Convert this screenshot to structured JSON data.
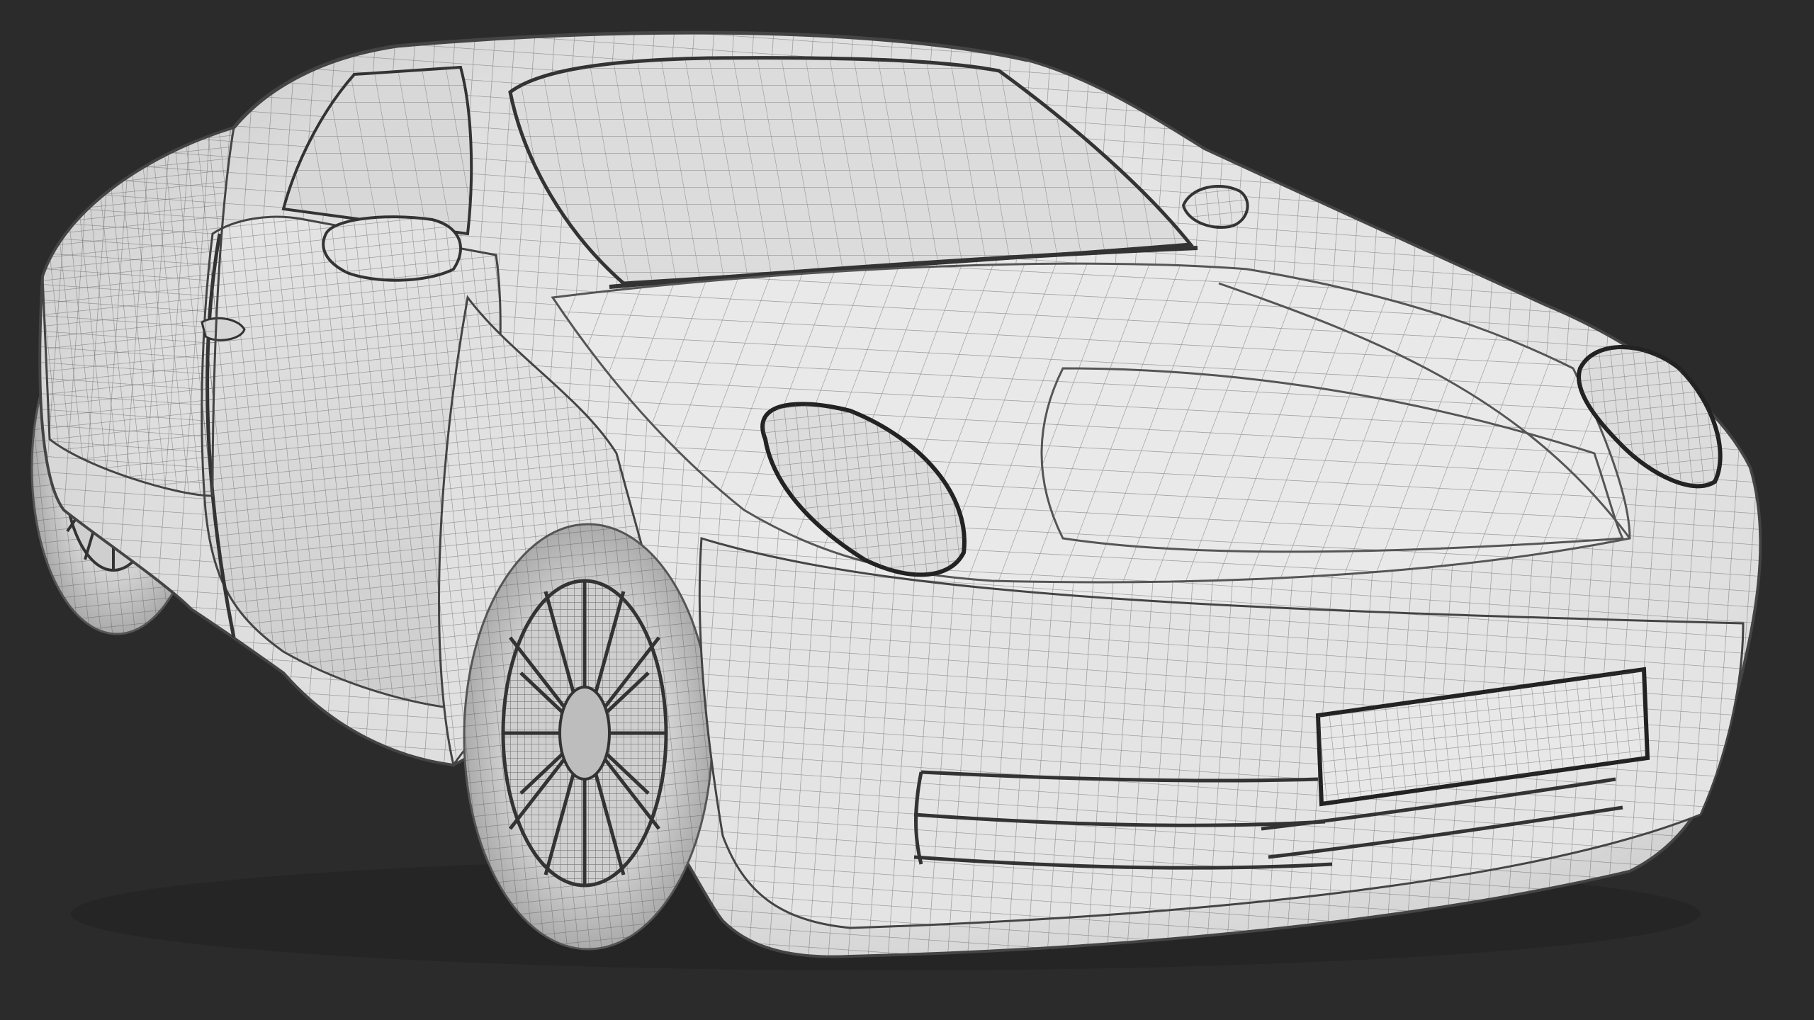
{
  "viewport": {
    "background_color": "#2b2b2b",
    "subject": "car-wireframe-render",
    "shading": "white-clay",
    "wire_color": "#3a3a3a"
  },
  "model": {
    "body_color": "#e6e6e6",
    "glass_color": "#dcdcdc",
    "tire_color": "#cfcfcf",
    "rim_color": "#bdbdbd",
    "shadow_color": "#8e8e8e"
  }
}
